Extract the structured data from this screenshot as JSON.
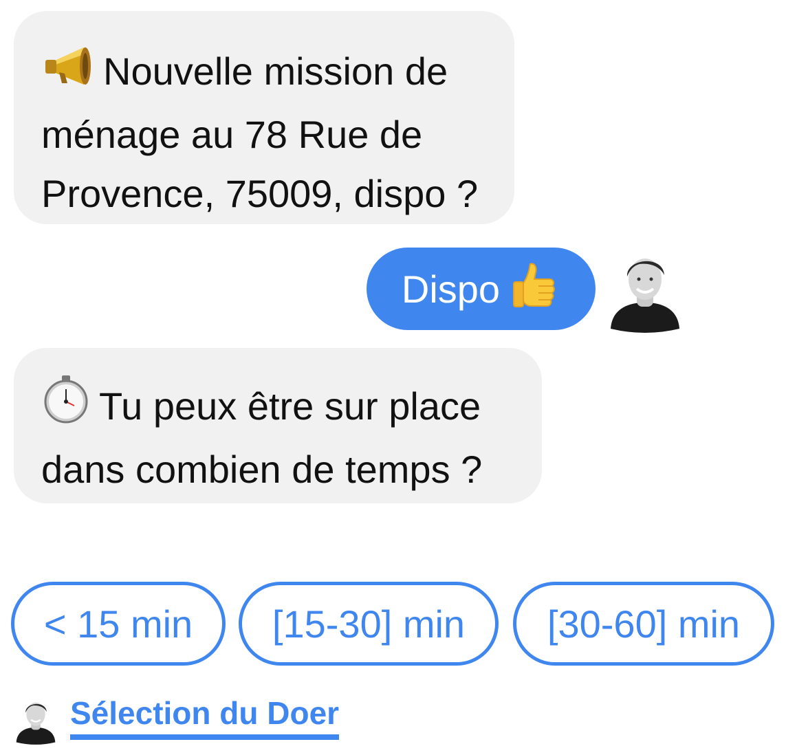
{
  "conversation": {
    "messages": [
      {
        "sender": "bot",
        "icon": "megaphone-icon",
        "lines": [
          "Nouvelle mission de",
          "ménage au 78 Rue de",
          "Provence, 75009, dispo ?"
        ]
      },
      {
        "sender": "user",
        "text": "Dispo",
        "icon": "thumbs-up-icon"
      },
      {
        "sender": "bot",
        "icon": "stopwatch-icon",
        "lines": [
          "Tu peux être sur place",
          "dans combien de temps ?"
        ]
      }
    ]
  },
  "quick_replies": [
    {
      "label": "< 15 min"
    },
    {
      "label": "[15-30] min"
    },
    {
      "label": "[30-60] min"
    }
  ],
  "footer": {
    "link_label": "Sélection du Doer"
  },
  "colors": {
    "accent": "#3f87ef",
    "bubble_incoming": "#f1f1f1",
    "background": "#ffffff"
  }
}
